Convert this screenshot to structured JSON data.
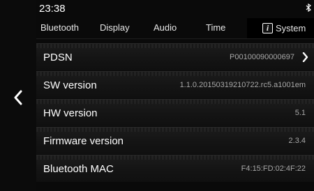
{
  "status_bar": {
    "time": "23:38",
    "bluetooth_icon": "bluetooth-icon"
  },
  "tabs": [
    {
      "label": "Bluetooth",
      "active": false
    },
    {
      "label": "Display",
      "active": false
    },
    {
      "label": "Audio",
      "active": false
    },
    {
      "label": "Time",
      "active": false
    },
    {
      "label": "System",
      "active": true,
      "icon": "info-icon",
      "icon_glyph": "i"
    }
  ],
  "back_icon": "chevron-left-icon",
  "rows": [
    {
      "label": "PDSN",
      "value": "P00100090000697",
      "icon": "chevron-right-icon"
    },
    {
      "label": "SW version",
      "value": "1.1.0.20150319210722.rc5.a1001em"
    },
    {
      "label": "HW version",
      "value": "5.1"
    },
    {
      "label": "Firmware version",
      "value": "2.3.4"
    },
    {
      "label": "Bluetooth MAC",
      "value": "F4:15:FD:02:4F:22"
    }
  ],
  "colors": {
    "background": "#000000",
    "row_background": "#161616",
    "label": "#ffffff",
    "value": "#a8a8a8"
  }
}
